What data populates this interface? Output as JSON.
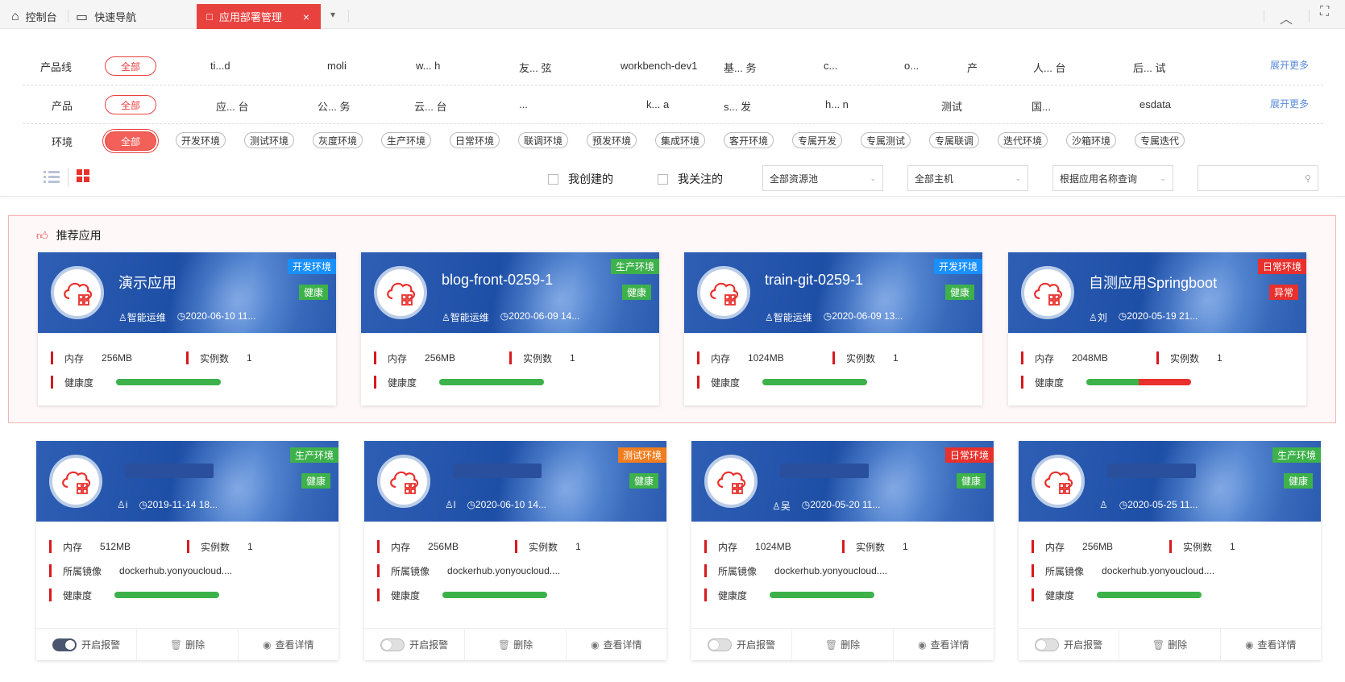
{
  "topbar": {
    "tabs": [
      {
        "label": "控制台",
        "icon": "home-icon"
      },
      {
        "label": "快速导航",
        "icon": "monitor-icon"
      }
    ],
    "active_tab": {
      "label": "应用部署管理",
      "icon": "document-icon",
      "close": "×"
    },
    "dropdown": "▾",
    "collapse": "︿",
    "fullscreen": "⛶"
  },
  "filters": {
    "product_line": {
      "label": "产品线",
      "all": "全部",
      "items": [
        "ti...d",
        "moli",
        "w... h",
        "友... 弦",
        "workbench-dev1",
        "基... 务",
        "c...",
        "o...",
        "产",
        "人... 台",
        "后... 试"
      ],
      "more": "展开更多"
    },
    "product": {
      "label": "产品",
      "all": "全部",
      "items": [
        "应... 台",
        "公... 务",
        "云... 台",
        "...",
        "k... a",
        "s... 发",
        "h... n",
        "测试",
        "国...",
        "esdata"
      ],
      "more": "展开更多"
    },
    "environment": {
      "label": "环境",
      "all": "全部",
      "items": [
        "开发环境",
        "测试环境",
        "灰度环境",
        "生产环境",
        "日常环境",
        "联调环境",
        "预发环境",
        "集成环境",
        "客开环境",
        "专属开发",
        "专属测试",
        "专属联调",
        "迭代环境",
        "沙箱环境",
        "专属迭代"
      ]
    }
  },
  "toolbar": {
    "my_created": "我创建的",
    "my_followed": "我关注的",
    "pool_select": "全部资源池",
    "host_select": "全部主机",
    "query_select": "根据应用名称查询",
    "search_placeholder": ""
  },
  "recommended": {
    "title": "推荐应用",
    "cards": [
      {
        "name": "演示应用",
        "owner": "智能运维",
        "time": "2020-06-10 11...",
        "env": "开发环境",
        "env_color": "#1890ff",
        "health": "健康",
        "health_color": "#3db14a",
        "memory_label": "内存",
        "memory": "256MB",
        "inst_label": "实例数",
        "instances": "1",
        "health_label": "健康度",
        "health_ok": 1.0
      },
      {
        "name": "blog-front-0259-1",
        "owner": "智能运维",
        "time": "2020-06-09 14...",
        "env": "生产环境",
        "env_color": "#3db14a",
        "health": "健康",
        "health_color": "#3db14a",
        "memory_label": "内存",
        "memory": "256MB",
        "inst_label": "实例数",
        "instances": "1",
        "health_label": "健康度",
        "health_ok": 1.0
      },
      {
        "name": "train-git-0259-1",
        "owner": "智能运维",
        "time": "2020-06-09 13...",
        "env": "开发环境",
        "env_color": "#1890ff",
        "health": "健康",
        "health_color": "#3db14a",
        "memory_label": "内存",
        "memory": "1024MB",
        "inst_label": "实例数",
        "instances": "1",
        "health_label": "健康度",
        "health_ok": 1.0
      },
      {
        "name": "自测应用Springboot",
        "owner": "刘",
        "time": "2020-05-19 21...",
        "env": "日常环境",
        "env_color": "#e8302c",
        "health": "异常",
        "health_color": "#e8302c",
        "memory_label": "内存",
        "memory": "2048MB",
        "inst_label": "实例数",
        "instances": "1",
        "health_label": "健康度",
        "health_ok": 0.5
      }
    ]
  },
  "apps": {
    "cards": [
      {
        "name": "",
        "owner": "i",
        "time": "2019-11-14 18...",
        "env": "生产环境",
        "env_color": "#3db14a",
        "health": "健康",
        "health_color": "#3db14a",
        "memory_label": "内存",
        "memory": "512MB",
        "inst_label": "实例数",
        "instances": "1",
        "image_label": "所属镜像",
        "image": "dockerhub.yonyoucloud....",
        "health_label": "健康度",
        "health_ok": 1.0,
        "alarm_on": true,
        "alarm": "开启报警",
        "delete": "删除",
        "detail": "查看详情"
      },
      {
        "name": "",
        "owner": "l",
        "time": "2020-06-10 14...",
        "env": "测试环境",
        "env_color": "#f07d1f",
        "health": "健康",
        "health_color": "#3db14a",
        "memory_label": "内存",
        "memory": "256MB",
        "inst_label": "实例数",
        "instances": "1",
        "image_label": "所属镜像",
        "image": "dockerhub.yonyoucloud....",
        "health_label": "健康度",
        "health_ok": 1.0,
        "alarm_on": false,
        "alarm": "开启报警",
        "delete": "删除",
        "detail": "查看详情"
      },
      {
        "name": "",
        "owner": "吴",
        "time": "2020-05-20 11...",
        "env": "日常环境",
        "env_color": "#e8302c",
        "health": "健康",
        "health_color": "#3db14a",
        "memory_label": "内存",
        "memory": "1024MB",
        "inst_label": "实例数",
        "instances": "1",
        "image_label": "所属镜像",
        "image": "dockerhub.yonyoucloud....",
        "health_label": "健康度",
        "health_ok": 1.0,
        "alarm_on": false,
        "alarm": "开启报警",
        "delete": "删除",
        "detail": "查看详情"
      },
      {
        "name": "",
        "owner": "",
        "time": "2020-05-25 11...",
        "env": "生产环境",
        "env_color": "#3db14a",
        "health": "健康",
        "health_color": "#3db14a",
        "memory_label": "内存",
        "memory": "256MB",
        "inst_label": "实例数",
        "instances": "1",
        "image_label": "所属镜像",
        "image": "dockerhub.yonyoucloud....",
        "health_label": "健康度",
        "health_ok": 1.0,
        "alarm_on": false,
        "alarm": "开启报警",
        "delete": "删除",
        "detail": "查看详情"
      }
    ]
  }
}
